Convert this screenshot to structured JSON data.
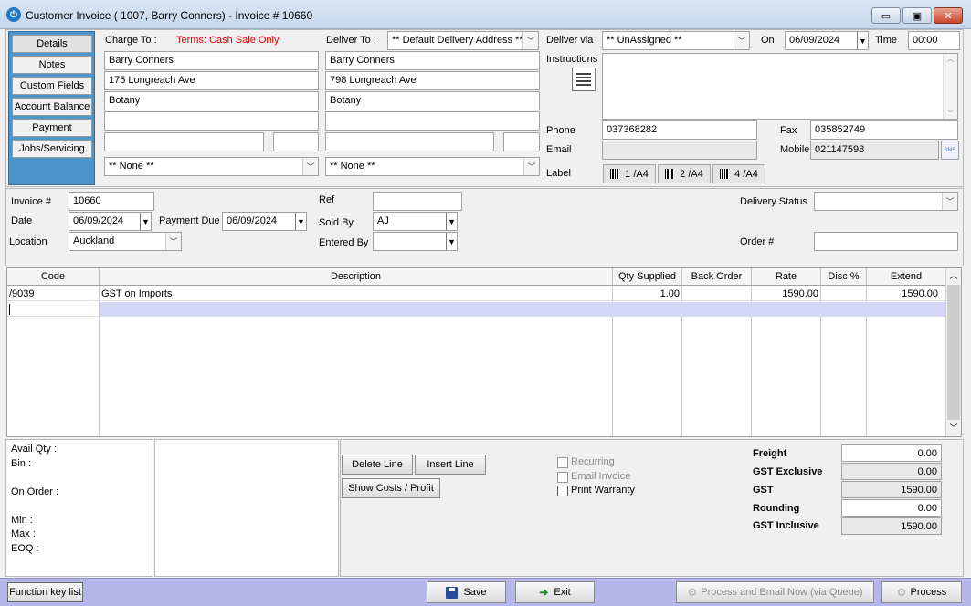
{
  "window": {
    "title": "Customer Invoice ( 1007, Barry Conners) - Invoice # 10660",
    "minimize": "▭",
    "maximize": "▣",
    "close": "✕"
  },
  "sidenav": {
    "items": [
      "Details",
      "Notes",
      "Custom Fields",
      "Account Balance",
      "Payment",
      "Jobs/Servicing"
    ]
  },
  "charge_to": {
    "label": "Charge To :",
    "terms": "Terms: Cash Sale Only",
    "lines": [
      "Barry Conners",
      "175 Longreach Ave",
      "Botany",
      ""
    ],
    "dropdown": "** None **"
  },
  "deliver_to": {
    "label": "Deliver To :",
    "address_select": "** Default Delivery Address **",
    "lines": [
      "Barry Conners",
      "798 Longreach Ave",
      "Botany",
      ""
    ],
    "dropdown": "** None **"
  },
  "delivery": {
    "via_label": "Deliver via",
    "via_value": "** UnAssigned **",
    "on_label": "On",
    "on_value": "06/09/2024",
    "time_label": "Time",
    "time_value": "00:00",
    "instructions_label": "Instructions",
    "instructions_value": "",
    "phone_label": "Phone",
    "phone_value": "037368282",
    "fax_label": "Fax",
    "fax_value": "035852749",
    "email_label": "Email",
    "email_value": "",
    "mobile_label": "Mobile",
    "mobile_value": "021147598",
    "sms_label": "SMS",
    "label_label": "Label",
    "label_buttons": [
      "1 /A4",
      "2 /A4",
      "4 /A4"
    ]
  },
  "invoice": {
    "number_label": "Invoice #",
    "number_value": "10660",
    "date_label": "Date",
    "date_value": "06/09/2024",
    "payment_due_label": "Payment Due",
    "payment_due_value": "06/09/2024",
    "location_label": "Location",
    "location_value": "Auckland",
    "ref_label": "Ref",
    "ref_value": "",
    "sold_by_label": "Sold By",
    "sold_by_value": "AJ",
    "entered_by_label": "Entered By",
    "entered_by_value": "",
    "delivery_status_label": "Delivery Status",
    "delivery_status_value": "",
    "order_label": "Order #",
    "order_value": ""
  },
  "grid": {
    "columns": [
      "Code",
      "Description",
      "Qty Supplied",
      "Back Order",
      "Rate",
      "Disc %",
      "Extend"
    ],
    "rows": [
      {
        "code": "/9039",
        "description": "GST on Imports",
        "qty": "1.00",
        "back_order": "",
        "rate": "1590.00",
        "disc": "",
        "extend": "1590.00"
      }
    ]
  },
  "stock": {
    "avail_qty": "Avail Qty :",
    "bin": "Bin :",
    "on_order": "On Order :",
    "min": "Min :",
    "max": "Max :",
    "eoq": "EOQ :"
  },
  "actions": {
    "delete_line": "Delete Line",
    "insert_line": "Insert Line",
    "show_costs": "Show Costs / Profit"
  },
  "options": {
    "recurring": "Recurring",
    "email_invoice": "Email Invoice",
    "print_warranty": "Print Warranty"
  },
  "totals": {
    "freight_label": "Freight",
    "freight_value": "0.00",
    "gst_exclusive_label": "GST Exclusive",
    "gst_exclusive_value": "0.00",
    "gst_label": "GST",
    "gst_value": "1590.00",
    "rounding_label": "Rounding",
    "rounding_value": "0.00",
    "gst_inclusive_label": "GST Inclusive",
    "gst_inclusive_value": "1590.00"
  },
  "footer": {
    "function_key_list": "Function key list",
    "save": "Save",
    "exit": "Exit",
    "process_email": "Process and Email Now (via Queue)",
    "process": "Process"
  },
  "colors": {
    "terms_red": "#e00000",
    "nav_blue": "#4a96cc",
    "selected_row": "#d6d6f6",
    "bottom_bar": "#b5b5ec"
  }
}
